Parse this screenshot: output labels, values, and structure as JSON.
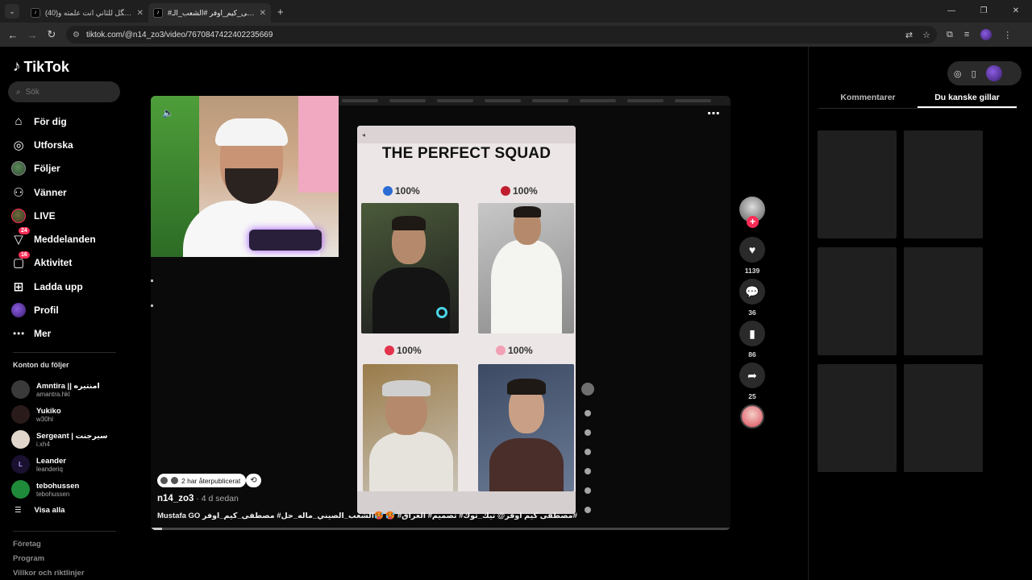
{
  "browser": {
    "tabs": [
      {
        "title": "(40)واحد يگل للثاني انت علمته و..."
      },
      {
        "title": "#مصطفى_كيم_اوفر #الشعب_الـ..."
      }
    ],
    "url": "tiktok.com/@n14_zo3/video/7670847422402235669"
  },
  "sidebar": {
    "logo": "TikTok",
    "search_placeholder": "Sök",
    "nav": [
      {
        "label": "För dig",
        "icon": "home-icon"
      },
      {
        "label": "Utforska",
        "icon": "compass-icon"
      },
      {
        "label": "Följer",
        "icon": "following-avatar-icon"
      },
      {
        "label": "Vänner",
        "icon": "friends-icon"
      },
      {
        "label": "LIVE",
        "icon": "live-avatar-icon"
      },
      {
        "label": "Meddelanden",
        "icon": "messages-icon",
        "badge": "24"
      },
      {
        "label": "Aktivitet",
        "icon": "activity-icon",
        "badge": "16"
      },
      {
        "label": "Ladda upp",
        "icon": "upload-icon"
      },
      {
        "label": "Profil",
        "icon": "profile-avatar-icon"
      },
      {
        "label": "Mer",
        "icon": "more-icon"
      }
    ],
    "following_title": "Konton du följer",
    "following": [
      {
        "name": "Amntira || امنتيره",
        "handle": "amantra.hkl"
      },
      {
        "name": "Yukiko",
        "handle": "w30hl"
      },
      {
        "name": "Sergeant | سيرجنت",
        "handle": "i.xh4"
      },
      {
        "name": "Leander",
        "handle": "leanderiq"
      },
      {
        "name": "tebohussen",
        "handle": "tebohussen"
      }
    ],
    "show_all": "Visa alla",
    "footer": [
      "Företag",
      "Program",
      "Villkor och riktlinjer"
    ]
  },
  "video": {
    "overlay_title": "THE PERFECT SQUAD",
    "percent_labels": [
      "100%",
      "100%",
      "100%",
      "100%"
    ],
    "repost_label": "2 har återpublicerat",
    "author": "n14_zo3",
    "posted": " · 4 d sedan",
    "caption": "Mustafa GO مصطفى كيم اوفر@ تيك_توك# تصميم# العراق# 🥵 🥵الشعب_الصيني_ماله_حل# مصطفى_كيم_اوفر#",
    "progress": 0.02
  },
  "actions": {
    "likes": "1139",
    "comments": "36",
    "saves": "86",
    "shares": "25"
  },
  "right_panel": {
    "tabs": [
      "Kommentarer",
      "Du kanske gillar"
    ],
    "active_tab": 1
  },
  "colors": {
    "accent": "#fe2c55",
    "background": "#000000"
  }
}
